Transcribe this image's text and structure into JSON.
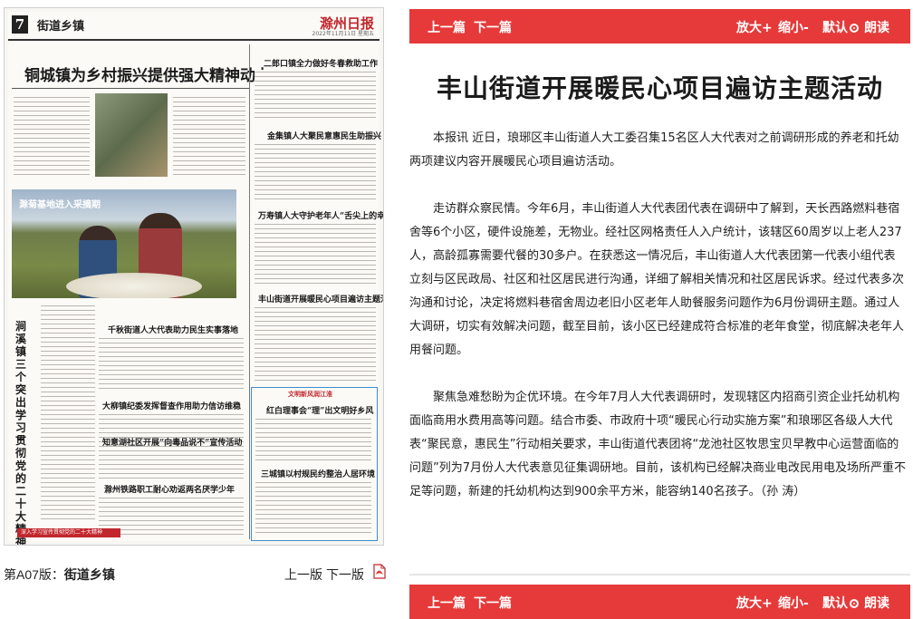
{
  "paper": {
    "page_no": "7",
    "section": "街道乡镇",
    "logo": "滁州日报",
    "date": "2022年11月11日 星期五",
    "lead_title": "铜城镇为乡村振兴提供强大精神动力",
    "headlines": [
      "二郎口镇全力做好冬春救助工作",
      "金集镇人大聚民意惠民生助振兴",
      "万寿镇人大守护老年人“舌尖上的幸福”",
      "丰山街道开展暖民心项目遍访主题活动",
      "千秋街道人大代表助力民生实事落地",
      "大柳镇纪委发挥督查作用助力信访维稳",
      "知意湖社区开展“向毒品说不”宣传活动",
      "滁州铁路职工耐心劝返两名厌学少年",
      "红白理事会“理”出文明好乡风",
      "三城镇以村规民约整治人居环境"
    ],
    "photo_caption": "滁菊基地进入采摘期",
    "vertical_title": "涧溪镇三个突出学习贯彻党的二十大精神",
    "box_tag": "文明新风润江淮",
    "footer_tag": "深入学习宣传贯彻党的二十大精神"
  },
  "page_nav": {
    "label_prefix": "第A07版：",
    "label_section": "街道乡镇",
    "prev": "上一版",
    "next": "下一版",
    "pdf_icon": "pdf-icon"
  },
  "toolbar": {
    "prev": "上一篇",
    "next": "下一篇",
    "zoom_in": "放大+",
    "zoom_out": "缩小-",
    "default": "默认",
    "read": "朗读"
  },
  "article": {
    "title": "丰山街道开展暖民心项目遍访主题活动",
    "paragraphs": [
      "本报讯 近日，琅琊区丰山街道人大工委召集15名区人大代表对之前调研形成的养老和托幼两项建议内容开展暖民心项目遍访活动。",
      "走访群众察民情。今年6月，丰山街道人大代表团代表在调研中了解到，天长西路燃料巷宿舍等6个小区，硬件设施差，无物业。经社区网格责任人入户统计，该辖区60周岁以上老人237人，高龄孤寡需要代餐的30多户。在获悉这一情况后，丰山街道人大代表团第一代表小组代表立刻与区民政局、社区和社区居民进行沟通，详细了解相关情况和社区居民诉求。经过代表多次沟通和讨论，决定将燃料巷宿舍周边老旧小区老年人助餐服务问题作为6月份调研主题。通过人大调研，切实有效解决问题，截至目前，该小区已经建成符合标准的老年食堂，彻底解决老年人用餐问题。",
      "聚焦急难愁盼为企优环境。在今年7月人大代表调研时，发现辖区内招商引资企业托幼机构面临商用水费用高等问题。结合市委、市政府十项“暖民心行动实施方案”和琅琊区各级人大代表“聚民意，惠民生”行动相关要求，丰山街道代表团将“龙池社区牧思宝贝早教中心运营面临的问题”列为7月份人大代表意见征集调研地。目前，该机构已经解决商业电改民用电及场所严重不足等问题，新建的托幼机构达到900余平方米，能容纳140名孩子。（孙 涛）"
    ]
  }
}
